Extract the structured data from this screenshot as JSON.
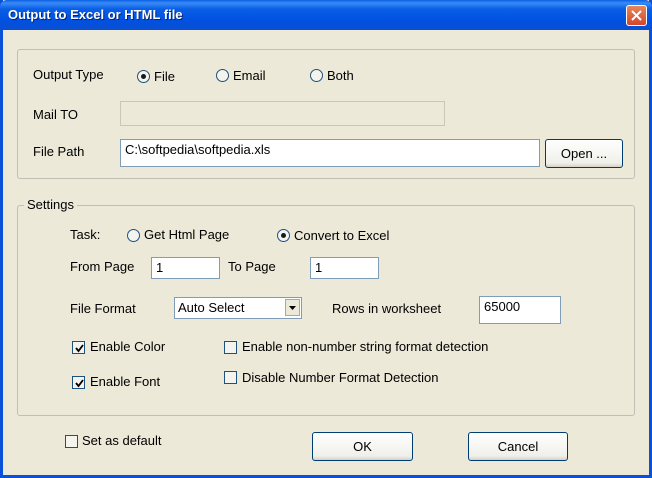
{
  "window": {
    "title": "Output to Excel or HTML file"
  },
  "output_group": {
    "output_type_label": "Output Type",
    "options": [
      {
        "label": "File",
        "checked": true
      },
      {
        "label": "Email",
        "checked": false
      },
      {
        "label": "Both",
        "checked": false
      }
    ],
    "mail_to_label": "Mail TO",
    "mail_to_value": "",
    "file_path_label": "File Path",
    "file_path_value": "C:\\softpedia\\softpedia.xls",
    "open_button": "Open ..."
  },
  "settings_group": {
    "legend": "Settings",
    "task_label": "Task:",
    "task_options": [
      {
        "label": "Get Html Page",
        "checked": false
      },
      {
        "label": "Convert to Excel",
        "checked": true
      }
    ],
    "from_page_label": "From Page",
    "from_page_value": "1",
    "to_page_label": "To Page",
    "to_page_value": "1",
    "file_format_label": "File Format",
    "file_format_value": "Auto Select",
    "rows_label": "Rows in worksheet",
    "rows_value": "65000",
    "checkboxes": [
      {
        "label": "Enable Color",
        "checked": true
      },
      {
        "label": "Enable Font",
        "checked": true
      },
      {
        "label": "Enable non-number string format detection",
        "checked": false
      },
      {
        "label": "Disable Number Format Detection",
        "checked": false
      }
    ]
  },
  "footer": {
    "set_default_label": "Set as default",
    "set_default_checked": false,
    "ok_button": "OK",
    "cancel_button": "Cancel"
  }
}
